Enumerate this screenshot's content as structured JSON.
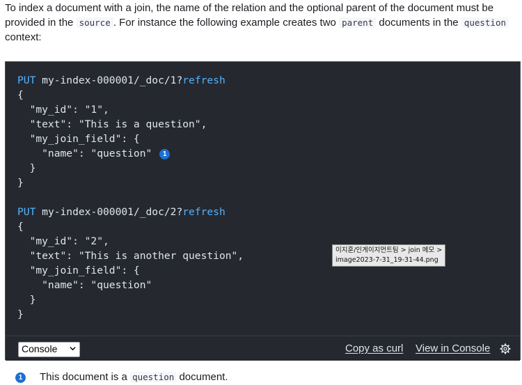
{
  "intro": {
    "part1": "To index a document with a join, the name of the relation and the optional parent of the document must be provided in the ",
    "code1": "source",
    "part2": ". For instance the following example creates two ",
    "code2": "parent",
    "part3": " documents in the ",
    "code3": "question",
    "part4": " context:"
  },
  "code": {
    "req1": {
      "method": "PUT",
      "path": "my-index-000001/_doc/1?",
      "param": "refresh",
      "lines": [
        "{",
        "  \"my_id\": \"1\",",
        "  \"text\": \"This is a question\",",
        "  \"my_join_field\": {",
        "    \"name\": \"question\"",
        "  }",
        "}"
      ],
      "callout": "1"
    },
    "req2": {
      "method": "PUT",
      "path": "my-index-000001/_doc/2?",
      "param": "refresh",
      "lines": [
        "{",
        "  \"my_id\": \"2\",",
        "  \"text\": \"This is another question\",",
        "  \"my_join_field\": {",
        "    \"name\": \"question\"",
        "  }",
        "}"
      ]
    }
  },
  "tooltip": {
    "line1": "이지훈/인게이지먼트팀 > join 메모 >",
    "line2": "image2023-7-31_19-31-44.png"
  },
  "toolbar": {
    "language_selected": "Console",
    "copy_label": "Copy as curl",
    "console_label": "View in Console"
  },
  "note": {
    "callout": "1",
    "part1": "This document is a ",
    "code": "question",
    "part2": " document."
  },
  "colors": {
    "code_bg": "#25282f",
    "method": "#54b3ff",
    "callout": "#1e6fd0"
  }
}
